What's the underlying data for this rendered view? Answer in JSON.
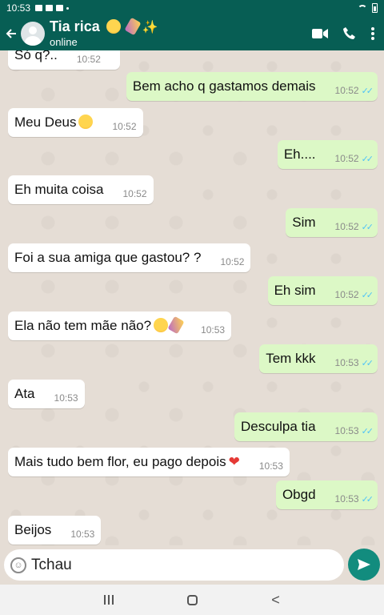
{
  "status_bar": {
    "time": "10:53"
  },
  "header": {
    "title": "Tia rica",
    "subtitle": "online"
  },
  "messages": [
    {
      "dir": "in",
      "text": "Só q?..",
      "time": "10:52"
    },
    {
      "dir": "out",
      "text": "Bem acho q gastamos demais",
      "time": "10:52"
    },
    {
      "dir": "in",
      "text": "Meu Deus",
      "time": "10:52"
    },
    {
      "dir": "out",
      "text": "Eh....",
      "time": "10:52"
    },
    {
      "dir": "in",
      "text": "Eh muita coisa",
      "time": "10:52"
    },
    {
      "dir": "out",
      "text": "Sim",
      "time": "10:52"
    },
    {
      "dir": "in",
      "text": "Foi a sua amiga que gastou? ?",
      "time": "10:52"
    },
    {
      "dir": "out",
      "text": "Eh sim",
      "time": "10:52"
    },
    {
      "dir": "in",
      "text": "Ela não tem mãe não?",
      "time": "10:53"
    },
    {
      "dir": "out",
      "text": "Tem kkk",
      "time": "10:53"
    },
    {
      "dir": "in",
      "text": "Ata",
      "time": "10:53"
    },
    {
      "dir": "out",
      "text": "Desculpa tia",
      "time": "10:53"
    },
    {
      "dir": "in",
      "text": "Mais tudo bem flor, eu pago depois",
      "time": "10:53"
    },
    {
      "dir": "out",
      "text": "Obgd",
      "time": "10:53"
    },
    {
      "dir": "in",
      "text": "Beijos",
      "time": "10:53"
    }
  ],
  "input": {
    "value": "Tchau"
  },
  "icons": {
    "back": "arrow-left-icon",
    "video": "video-call-icon",
    "call": "phone-icon",
    "menu": "more-vert-icon",
    "emoji": "emoji-icon",
    "send": "send-icon"
  },
  "colors": {
    "header": "#075e54",
    "outgoing_bubble": "#dcf8c6",
    "incoming_bubble": "#ffffff",
    "send_button": "#128c7e",
    "read_ticks": "#4fc3f7"
  }
}
